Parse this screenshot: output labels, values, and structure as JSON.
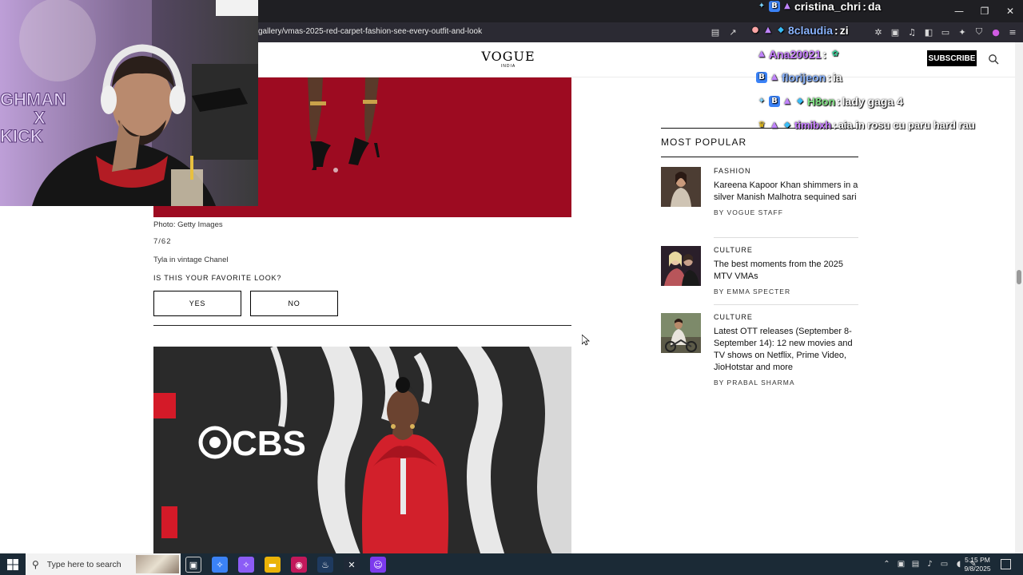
{
  "browser": {
    "url": "gallery/vmas-2025-red-carpet-fashion-see-every-outfit-and-look",
    "window_controls": [
      "—",
      "❐",
      "✕"
    ]
  },
  "site": {
    "logo": "VOGUE",
    "logo_sub": "INDIA",
    "subscribe_label": "SUBSCRIBE"
  },
  "gallery": {
    "photo_credit": "Photo: Getty Images",
    "counter": "7/62",
    "caption": "Tyla in vintage Chanel",
    "favorite_question": "IS THIS YOUR FAVORITE LOOK?",
    "yes_label": "YES",
    "no_label": "NO",
    "next_photo_brand": "CBS"
  },
  "sidebar": {
    "title": "MOST POPULAR",
    "articles": [
      {
        "category": "FASHION",
        "title": "Kareena Kapoor Khan shimmers in a silver Manish Malhotra sequined sari",
        "byline": "BY VOGUE STAFF"
      },
      {
        "category": "CULTURE",
        "title": "The best moments from the 2025 MTV VMAs",
        "byline": "BY EMMA SPECTER"
      },
      {
        "category": "CULTURE",
        "title": "Latest OTT releases (September 8-September 14): 12 new movies and TV shows on Netflix, Prime Video, JioHotstar and more",
        "byline": "BY PRABAL SHARMA"
      }
    ]
  },
  "webcam": {
    "overlay_text": [
      "GHMAN",
      "X",
      "KICK"
    ]
  },
  "chat": {
    "messages": [
      {
        "user": "cristina_chri",
        "text": "da",
        "color": "#ffffff"
      },
      {
        "user": "8claudia",
        "text": "zi",
        "color": "#8ab4ff"
      },
      {
        "user": "Ana20021",
        "text": "",
        "color": "#c77dff"
      },
      {
        "user": "florijeon",
        "text": "ia",
        "color": "#8ab4ff"
      },
      {
        "user": "H8on",
        "text": "lady gaga 4",
        "color": "#7ee081"
      },
      {
        "user": "timibxh",
        "text": "aia in rosu cu paru hard rau",
        "color": "#c77dff"
      }
    ]
  },
  "taskbar": {
    "search_placeholder": "Type here to search",
    "time": "5:15 PM",
    "date": "9/8/2025"
  },
  "colors": {
    "accent_red": "#a50d24",
    "page_bg": "#ffffff",
    "chrome_bg": "#2b2a33",
    "taskbar_bg": "#1b2a36"
  }
}
